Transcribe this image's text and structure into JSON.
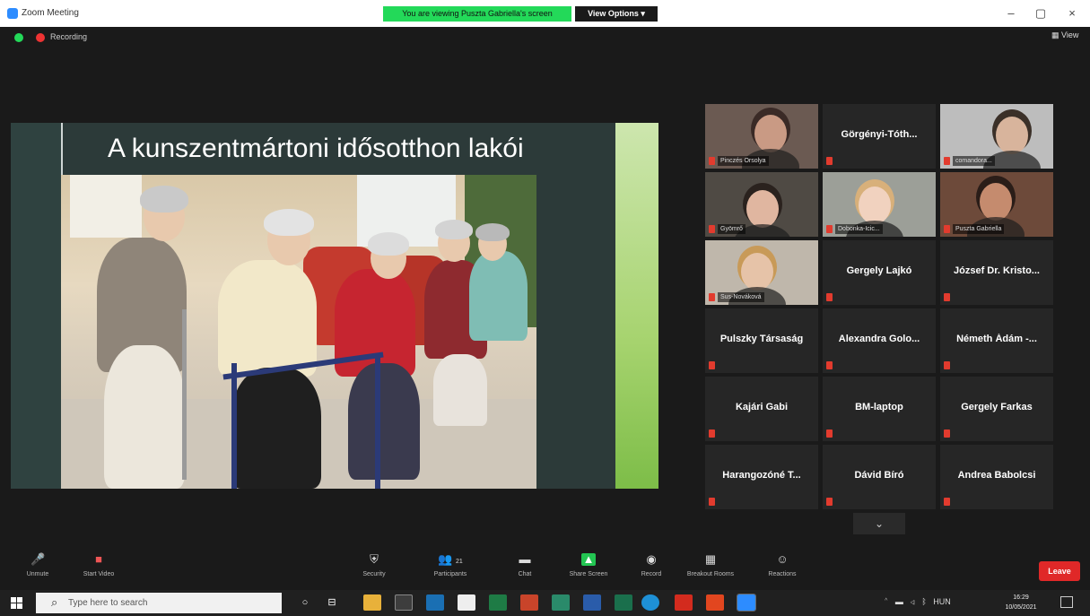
{
  "window": {
    "title": "Zoom Meeting",
    "share_banner": "You are viewing Puszta Gabriella's screen",
    "view_options": "View Options ▾",
    "minimize": "–",
    "maximize": "▢",
    "close": "×"
  },
  "meeting": {
    "recording_label": "Recording",
    "view_label": "▦ View"
  },
  "slide": {
    "title": "A kunszentmártoni idősotthon lakói"
  },
  "gallery": {
    "tiles": [
      {
        "name": "Pinczés Orsolya",
        "video": true
      },
      {
        "name": "Görgényi-Tóth...",
        "video": false
      },
      {
        "name": "comandora...",
        "video": true
      },
      {
        "name": "Gyömrő",
        "video": true
      },
      {
        "name": "Dobonka-Icic...",
        "video": true
      },
      {
        "name": "Puszta Gabriella",
        "video": true
      },
      {
        "name": "Sus-Nováková",
        "video": true
      },
      {
        "name": "Gergely Lajkó",
        "video": false
      },
      {
        "name": "József Dr. Kristo...",
        "video": false
      },
      {
        "name": "Pulszky Társaság",
        "video": false
      },
      {
        "name": "Alexandra Golo...",
        "video": false
      },
      {
        "name": "Németh Ádám -...",
        "video": false
      },
      {
        "name": "Kajári Gabi",
        "video": false
      },
      {
        "name": "BM-laptop",
        "video": false
      },
      {
        "name": "Gergely Farkas",
        "video": false
      },
      {
        "name": "Harangozóné T...",
        "video": false
      },
      {
        "name": "Dávid Bíró",
        "video": false
      },
      {
        "name": "Andrea Babolcsi",
        "video": false
      }
    ],
    "page_down": "⌄"
  },
  "toolbar": {
    "unmute": "Unmute",
    "start_video": "Start Video",
    "security": "Security",
    "participants": "Participants",
    "participants_count": "21",
    "chat": "Chat",
    "share_screen": "Share Screen",
    "record": "Record",
    "breakout_rooms": "Breakout Rooms",
    "reactions": "Reactions",
    "leave": "Leave"
  },
  "taskbar": {
    "search_placeholder": "Type here to search",
    "language": "HUN",
    "time": "16:29",
    "date": "10/05/2021"
  }
}
